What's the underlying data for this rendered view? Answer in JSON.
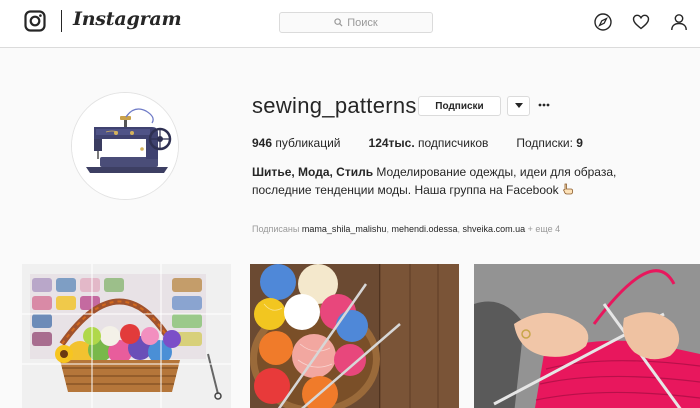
{
  "header": {
    "wordmark": "Instagram",
    "search_placeholder": "Поиск"
  },
  "profile": {
    "username": "sewing_patterns",
    "subscribe_label": "Подписки",
    "stats": {
      "posts_count": "946",
      "posts_label": "публикаций",
      "followers_count": "124тыс.",
      "followers_label": "подписчиков",
      "following_label": "Подписки:",
      "following_count": "9"
    },
    "bio": {
      "name": "Шитье, Мода, Стиль",
      "text": "Моделирование одежды, идеи для образа, последние тенденции моды. Наша группа на Facebook"
    },
    "followed_by": {
      "label": "Подписаны",
      "accounts": [
        "mama_shila_malishu",
        "mehendi.odessa",
        "shveika.com.ua"
      ],
      "more": "+ еще 4"
    }
  },
  "icons": {
    "logo": "instagram-logo-icon",
    "search": "search-icon",
    "explore": "compass-icon",
    "activity": "heart-icon",
    "profile": "user-icon",
    "dropdown": "chevron-down-icon",
    "more": "more-icon",
    "pointer": "pointing-hand-icon"
  },
  "colors": {
    "background": "#fafafa",
    "text": "#262626",
    "muted": "#999999",
    "border": "#dbdbdb"
  }
}
